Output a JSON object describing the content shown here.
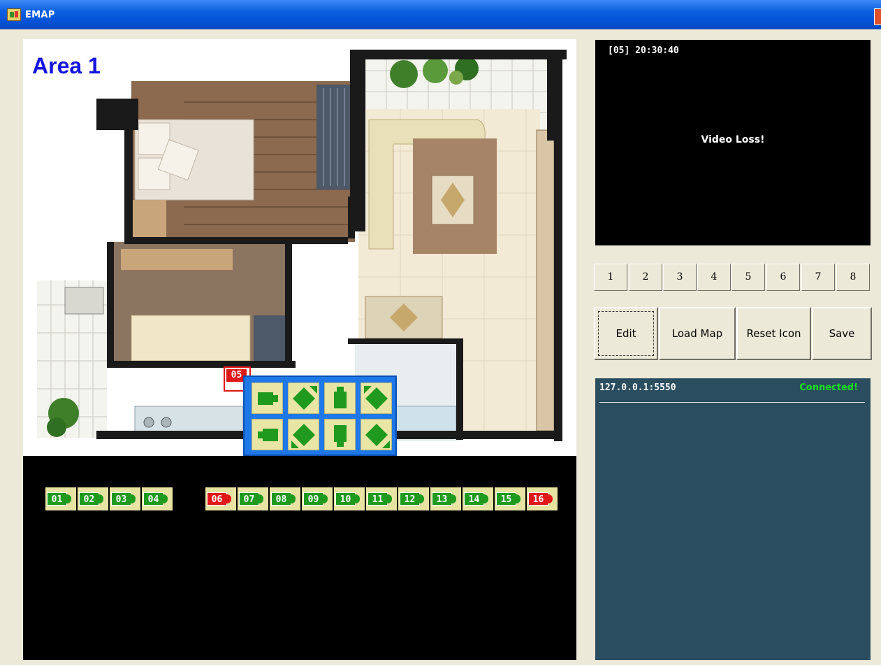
{
  "window": {
    "title": "EMAP"
  },
  "map": {
    "area_label": "Area 1"
  },
  "placed_camera": {
    "label": "05",
    "status": "alarm"
  },
  "tray_cameras": [
    {
      "label": "01",
      "status": "ok"
    },
    {
      "label": "02",
      "status": "ok"
    },
    {
      "label": "03",
      "status": "ok"
    },
    {
      "label": "04",
      "status": "ok"
    },
    {
      "label": "06",
      "status": "alarm"
    },
    {
      "label": "07",
      "status": "ok"
    },
    {
      "label": "08",
      "status": "ok"
    },
    {
      "label": "09",
      "status": "ok"
    },
    {
      "label": "10",
      "status": "ok"
    },
    {
      "label": "11",
      "status": "ok"
    },
    {
      "label": "12",
      "status": "ok"
    },
    {
      "label": "13",
      "status": "ok"
    },
    {
      "label": "14",
      "status": "ok"
    },
    {
      "label": "15",
      "status": "ok"
    },
    {
      "label": "16",
      "status": "alarm"
    }
  ],
  "direction_picker": {
    "directions": [
      "east",
      "northeast",
      "north",
      "northwest",
      "west",
      "southwest",
      "south",
      "southeast"
    ]
  },
  "video": {
    "timestamp": "[05] 20:30:40",
    "message": "Video Loss!"
  },
  "channels": [
    "1",
    "2",
    "3",
    "4",
    "5",
    "6",
    "7",
    "8"
  ],
  "actions": {
    "edit": "Edit",
    "load_map": "Load Map",
    "reset_icon": "Reset Icon",
    "save": "Save"
  },
  "connection": {
    "address": "127.0.0.1:5550",
    "status": "Connected!"
  },
  "colors": {
    "ok": "#1f9a1f",
    "alarm": "#e01818",
    "picker_bg": "#1e78e8",
    "status_panel": "#2a4d60",
    "connected_text": "#18e818",
    "area_label": "#1515e0"
  }
}
